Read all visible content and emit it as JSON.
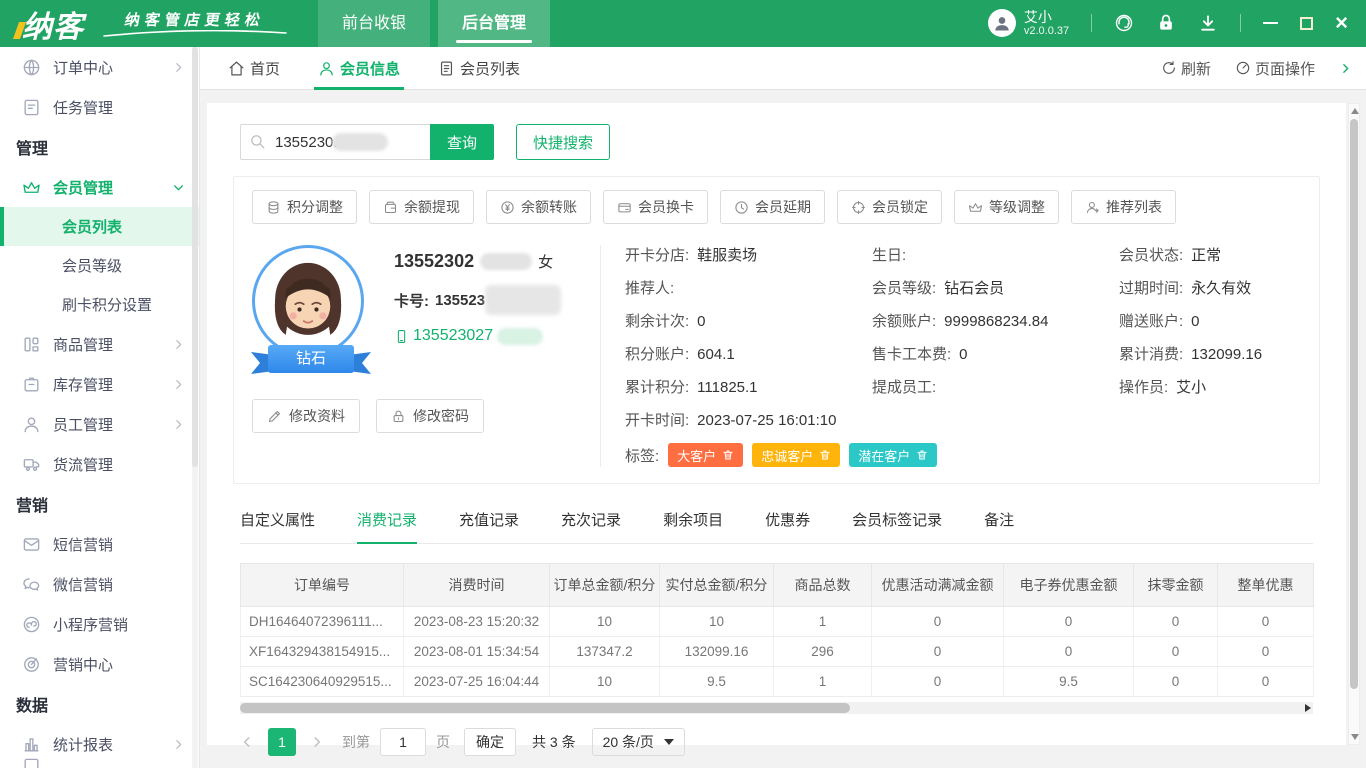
{
  "topbar": {
    "logo": "纳客",
    "slogan": "纳客管店更轻松",
    "tabs": [
      {
        "label": "前台收银"
      },
      {
        "label": "后台管理"
      }
    ],
    "user": {
      "name": "艾小",
      "version": "v2.0.0.37"
    },
    "icons": [
      "user-avatar-icon",
      "customer-service-icon",
      "lock-icon",
      "download-icon",
      "minimize-icon",
      "maximize-icon",
      "close-icon"
    ]
  },
  "sidebar": {
    "items": [
      {
        "label": "订单中心",
        "type": "group",
        "icon": "globe-icon"
      },
      {
        "label": "任务管理",
        "type": "item",
        "icon": "task-icon"
      },
      {
        "label": "管理",
        "type": "section"
      },
      {
        "label": "会员管理",
        "type": "group-expanded",
        "icon": "crown-icon"
      },
      {
        "label": "会员列表",
        "type": "sub-active"
      },
      {
        "label": "会员等级",
        "type": "sub"
      },
      {
        "label": "刷卡积分设置",
        "type": "sub"
      },
      {
        "label": "商品管理",
        "type": "group",
        "icon": "goods-icon"
      },
      {
        "label": "库存管理",
        "type": "group",
        "icon": "inventory-icon"
      },
      {
        "label": "员工管理",
        "type": "group",
        "icon": "staff-icon"
      },
      {
        "label": "货流管理",
        "type": "item",
        "icon": "truck-icon"
      },
      {
        "label": "营销",
        "type": "section"
      },
      {
        "label": "短信营销",
        "type": "item",
        "icon": "sms-icon"
      },
      {
        "label": "微信营销",
        "type": "item",
        "icon": "wechat-icon"
      },
      {
        "label": "小程序营销",
        "type": "item",
        "icon": "miniprogram-icon"
      },
      {
        "label": "营销中心",
        "type": "item",
        "icon": "target-icon"
      },
      {
        "label": "数据",
        "type": "section"
      },
      {
        "label": "统计报表",
        "type": "group",
        "icon": "chart-icon"
      }
    ]
  },
  "nav": {
    "home": "首页",
    "member_info": "会员信息",
    "member_list": "会员列表",
    "refresh": "刷新",
    "page_ops": "页面操作"
  },
  "search": {
    "value": "1355230.",
    "redacted": true,
    "query_label": "查询",
    "quick_label": "快捷搜索"
  },
  "member": {
    "actions": [
      "积分调整",
      "余额提现",
      "余额转账",
      "会员换卡",
      "会员延期",
      "会员锁定",
      "等级调整",
      "推荐列表"
    ],
    "grade_badge": "钻石",
    "name_visible": "13552302",
    "gender": "女",
    "card_label": "卡号:",
    "card_visible": "135523",
    "phone_visible": "135523027",
    "edit_profile": "修改资料",
    "edit_password": "修改密码",
    "details": [
      [
        {
          "label": "开卡分店:",
          "value": "鞋服卖场"
        },
        {
          "label": "推荐人:",
          "value": ""
        },
        {
          "label": "剩余计次:",
          "value": "0"
        },
        {
          "label": "积分账户:",
          "value": "604.1"
        },
        {
          "label": "累计积分:",
          "value": "111825.1"
        }
      ],
      [
        {
          "label": "生日:",
          "value": ""
        },
        {
          "label": "会员等级:",
          "value": "钻石会员"
        },
        {
          "label": "余额账户:",
          "value": "9999868234.84"
        },
        {
          "label": "售卡工本费:",
          "value": "0"
        },
        {
          "label": "提成员工:",
          "value": ""
        }
      ],
      [
        {
          "label": "会员状态:",
          "value": "正常"
        },
        {
          "label": "过期时间:",
          "value": "永久有效"
        },
        {
          "label": "赠送账户:",
          "value": "0"
        },
        {
          "label": "累计消费:",
          "value": "132099.16"
        },
        {
          "label": "操作员:",
          "value": "艾小"
        }
      ]
    ],
    "open_time_label": "开卡时间:",
    "open_time": "2023-07-25 16:01:10",
    "tags_label": "标签:",
    "tags": [
      {
        "label": "大客户",
        "color": "#ff6e41"
      },
      {
        "label": "忠诚客户",
        "color": "#ffb40c"
      },
      {
        "label": "潜在客户",
        "color": "#2cc8c8"
      }
    ]
  },
  "record_tabs": [
    "自定义属性",
    "消费记录",
    "充值记录",
    "充次记录",
    "剩余项目",
    "优惠券",
    "会员标签记录",
    "备注"
  ],
  "table": {
    "headers": [
      "订单编号",
      "消费时间",
      "订单总金额/积分",
      "实付总金额/积分",
      "商品总数",
      "优惠活动满减金额",
      "电子券优惠金额",
      "抹零金额",
      "整单优惠"
    ],
    "rows": [
      [
        "DH16464072396111...",
        "2023-08-23 15:20:32",
        "10",
        "10",
        "1",
        "0",
        "0",
        "0",
        "0"
      ],
      [
        "XF164329438154915...",
        "2023-08-01 15:34:54",
        "137347.2",
        "132099.16",
        "296",
        "0",
        "0",
        "0",
        "0"
      ],
      [
        "SC164230640929515...",
        "2023-07-25 16:04:44",
        "10",
        "9.5",
        "1",
        "0",
        "9.5",
        "0",
        "0"
      ]
    ]
  },
  "pagination": {
    "current_page": "1",
    "goto_label": "到第",
    "goto_value": "1",
    "page_unit": "页",
    "confirm_label": "确定",
    "total_label": "共 3 条",
    "page_size": "20 条/页"
  },
  "colors": {
    "topbar_green": "#21a363",
    "primary_green": "#12b26d",
    "tag_red": "#ff6e41",
    "tag_amber": "#ffb40c",
    "tag_teal": "#2cc8c8",
    "ribbon_blue": "#3f95ea"
  }
}
